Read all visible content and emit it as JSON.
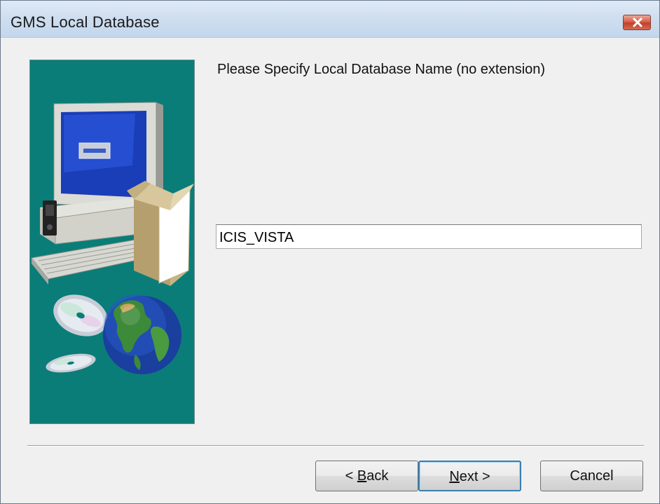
{
  "window": {
    "title": "GMS Local Database",
    "close_icon": "close-icon"
  },
  "main": {
    "prompt": "Please Specify Local Database Name (no extension)",
    "database_name_value": "ICIS_VISTA",
    "illustration_icons": [
      "computer-icon",
      "box-icon",
      "cd-icon",
      "globe-icon"
    ]
  },
  "buttons": {
    "back_prefix": "< ",
    "back_mnemonic": "B",
    "back_rest": "ack",
    "next_mnemonic": "N",
    "next_rest": "ext >",
    "cancel": "Cancel"
  },
  "colors": {
    "panel_background": "#0a7d78",
    "titlebar": "#cfdff0",
    "close_button": "#d9604a",
    "default_button_border": "#3c7fb1"
  }
}
